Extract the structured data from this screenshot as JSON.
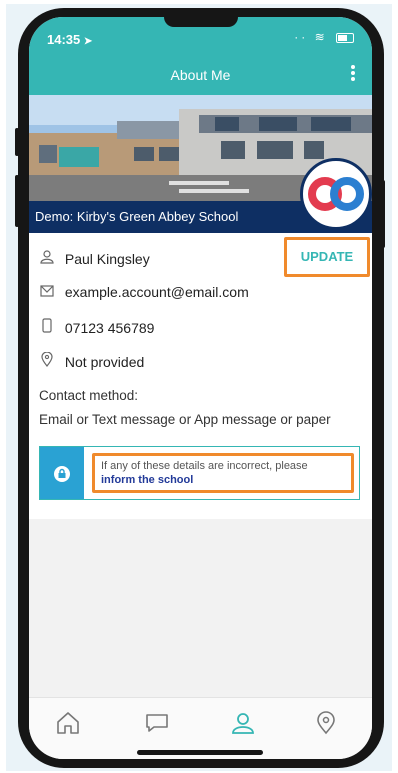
{
  "status_bar": {
    "time": "14:35"
  },
  "header": {
    "title": "About Me"
  },
  "school": {
    "name": "Demo: Kirby's Green Abbey School"
  },
  "profile": {
    "name": "Paul Kingsley",
    "email": "example.account@email.com",
    "phone": "07123 456789",
    "address": "Not provided",
    "update_label": "UPDATE",
    "contact_method_label": "Contact method:",
    "contact_method_value": "Email or Text message or App message or paper"
  },
  "notice": {
    "text": "If any of these details are incorrect, please",
    "link": "inform the school"
  },
  "colors": {
    "accent": "#35b6b4",
    "navy": "#0e2f63",
    "highlight": "#f08a2c",
    "lock_blue": "#2aa2d3",
    "link": "#223a99"
  },
  "tabbar": {
    "items": [
      "home-icon",
      "chat-icon",
      "profile-icon",
      "location-icon"
    ],
    "active": "profile-icon"
  }
}
